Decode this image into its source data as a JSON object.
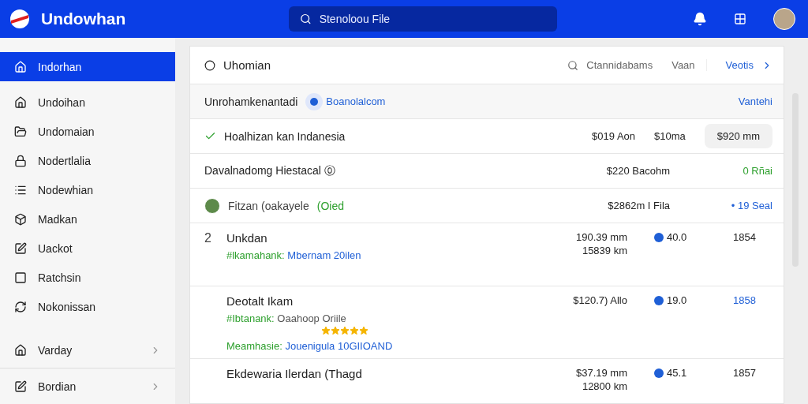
{
  "app": {
    "title": "Undowhan",
    "search": {
      "placeholder": "Stenoloou File"
    }
  },
  "sidebar": {
    "items": [
      {
        "label": "Indorhan",
        "selected": true
      },
      {
        "label": "Undoihan",
        "selected": false
      },
      {
        "label": "Undomaian",
        "selected": false
      },
      {
        "label": "Nodertlalia",
        "selected": false
      },
      {
        "label": "Nodewhian",
        "selected": false
      },
      {
        "label": "Madkan",
        "selected": false
      },
      {
        "label": "Uackot",
        "selected": false
      },
      {
        "label": "Ratchsin",
        "selected": false
      },
      {
        "label": "Nokonissan",
        "selected": false
      }
    ],
    "sections": [
      {
        "label": "Varday"
      },
      {
        "label": "Bordian"
      }
    ]
  },
  "panel": {
    "title": "Uhomian",
    "search_label": "Ctannidabams",
    "filter": "Vaan",
    "link": "Veotis",
    "subheader": {
      "label": "Unrohamkenantadi",
      "badge": "Boanolalcom",
      "action": "Vantehi"
    },
    "rows": [
      {
        "kind": "summary",
        "name": "Hoalhizan kan Indanesia",
        "values": [
          "$019 Aon",
          "$10ma"
        ],
        "pill": "$920 mm"
      },
      {
        "kind": "total",
        "name": "Davalnadomg Hiestacal ⓪",
        "values": [
          "$220 Bacohm"
        ],
        "status": "0 Rñai",
        "color": "#2ea02e"
      },
      {
        "kind": "person",
        "name": "Fitzan (oakayele",
        "tag": "(Oied",
        "values": [
          "$2862m I Fila"
        ],
        "status": "• 19 Seal",
        "color": "#1f5fd6"
      },
      {
        "kind": "item",
        "index": "2",
        "name": "Unkdan",
        "lines": [
          {
            "key": "#lkamahank:",
            "value": "Mbernam 20ilen",
            "kind": "link"
          }
        ],
        "values": [
          "190.39 mm",
          "15839 km"
        ],
        "score": "40.0",
        "count": "1854",
        "highlighted": false
      },
      {
        "kind": "item",
        "name": "Deotalt Ikam",
        "lines": [
          {
            "key": "#Ibtanank:",
            "value": "Oaahoop Oriile",
            "kind": "plain"
          },
          {
            "key": "Meamhasie:",
            "value": "Jouenigula 10GIIOAND",
            "kind": "link"
          }
        ],
        "stars": 5,
        "values": [
          "$120.7) Allo"
        ],
        "score": "19.0",
        "count": "1858",
        "highlighted": true
      },
      {
        "kind": "item",
        "name": "Ekdewaria Ilerdan (Thagd",
        "lines": [],
        "values": [
          "$37.19 mm",
          "12800 km"
        ],
        "score": "45.1",
        "count": "1857",
        "highlighted": false
      }
    ]
  }
}
